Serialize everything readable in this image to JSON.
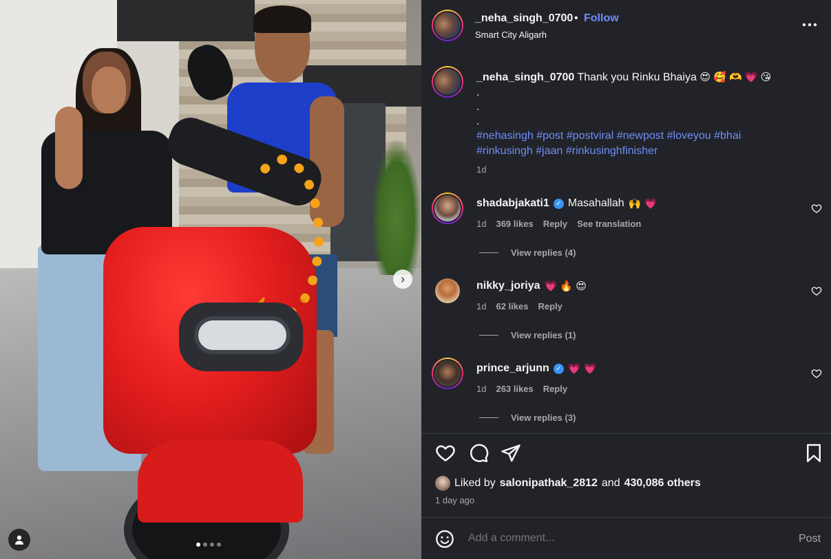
{
  "post": {
    "username": "_neha_singh_0700",
    "separator": "•",
    "follow_label": "Follow",
    "location": "Smart City Aligarh",
    "more_icon": "more-horizontal-icon",
    "carousel_next": "›",
    "carousel_total": 4,
    "carousel_current": 1
  },
  "caption": {
    "username": "_neha_singh_0700",
    "text": "Thank you Rinku Bhaiya",
    "emojis": "😍 🥰 🫶 💗 😘",
    "dot1": ".",
    "dot2": ".",
    "dot3": ".",
    "hashtags": "#nehasingh #post #postviral #newpost #loveyou #bhai #rinkusingh #jaan #rinkusinghfinisher",
    "time": "1d"
  },
  "comments": [
    {
      "username": "shadabjakati1",
      "verified": true,
      "text": "Masahallah",
      "emojis": "🙌 💗",
      "time": "1d",
      "likes": "369 likes",
      "reply": "Reply",
      "translate": "See translation",
      "view_replies": "View replies (4)"
    },
    {
      "username": "nikky_joriya",
      "verified": false,
      "text": "",
      "emojis": "💗 🔥 😍",
      "time": "1d",
      "likes": "62 likes",
      "reply": "Reply",
      "view_replies": "View replies (1)"
    },
    {
      "username": "prince_arjunn",
      "verified": true,
      "text": "",
      "emojis": "💗 💗",
      "time": "1d",
      "likes": "263 likes",
      "reply": "Reply",
      "view_replies": "View replies (3)"
    }
  ],
  "likes": {
    "prefix": "Liked by",
    "user": "salonipathak_2812",
    "and": "and",
    "others": "430,086 others",
    "ago": "1 day ago"
  },
  "comment_box": {
    "placeholder": "Add a comment...",
    "post_label": "Post"
  },
  "colors": {
    "background": "#212328",
    "link": "#6e8efb",
    "muted": "#a8a8a8",
    "verified": "#3a93f3"
  }
}
